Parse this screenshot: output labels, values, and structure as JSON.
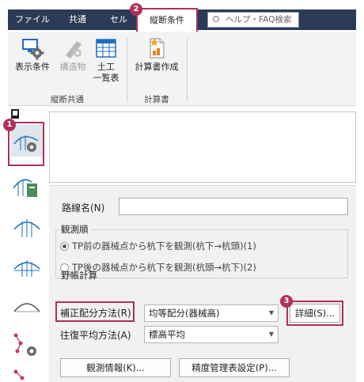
{
  "tabs": {
    "file": "ファイル",
    "common": "共通",
    "cell": "セル",
    "active": "縦断条件",
    "help_placeholder": "ヘルプ・FAQ検索"
  },
  "ribbon": {
    "buttons": [
      {
        "label": "表示条件",
        "label2": "",
        "icon": "monitor-gear-icon",
        "enabled": true
      },
      {
        "label": "構造物",
        "label2": "",
        "icon": "structure-icon",
        "enabled": false
      },
      {
        "label": "土工",
        "label2": "一覧表",
        "icon": "table-icon",
        "enabled": true
      },
      {
        "label": "計算書作成",
        "label2": "",
        "icon": "document-star-icon",
        "enabled": true
      }
    ],
    "groups": {
      "profile_common": "縦断共通",
      "calc_sheet": "計算書"
    }
  },
  "form": {
    "route_name_label": "路線名(N)",
    "route_name_value": "",
    "observation_order_title": "観測順",
    "radio_options": [
      {
        "label": "TP前の器械点から杭下を観測(杭下→杭頭)(1)",
        "selected": true
      },
      {
        "label": "TP後の器械点から杭下を観測(杭頭→杭下)(2)",
        "selected": false
      }
    ],
    "field_calc_title": "野帳計算",
    "correction_label": "補正配分方法(R)",
    "correction_value": "均等配分(器械高)",
    "detail_button": "詳細(S)...",
    "roundtrip_label": "往復平均方法(A)",
    "roundtrip_value": "標高平均",
    "observation_info_button": "観測情報(K)...",
    "accuracy_button": "精度管理表設定(P)..."
  },
  "badges": [
    "1",
    "2",
    "3"
  ],
  "colors": {
    "accent": "#b0305a",
    "tabbar": "#2b3a55",
    "icon_blue": "#1e6fc2",
    "icon_gear": "#6a6a6a",
    "icon_green": "#4c8c5c"
  }
}
